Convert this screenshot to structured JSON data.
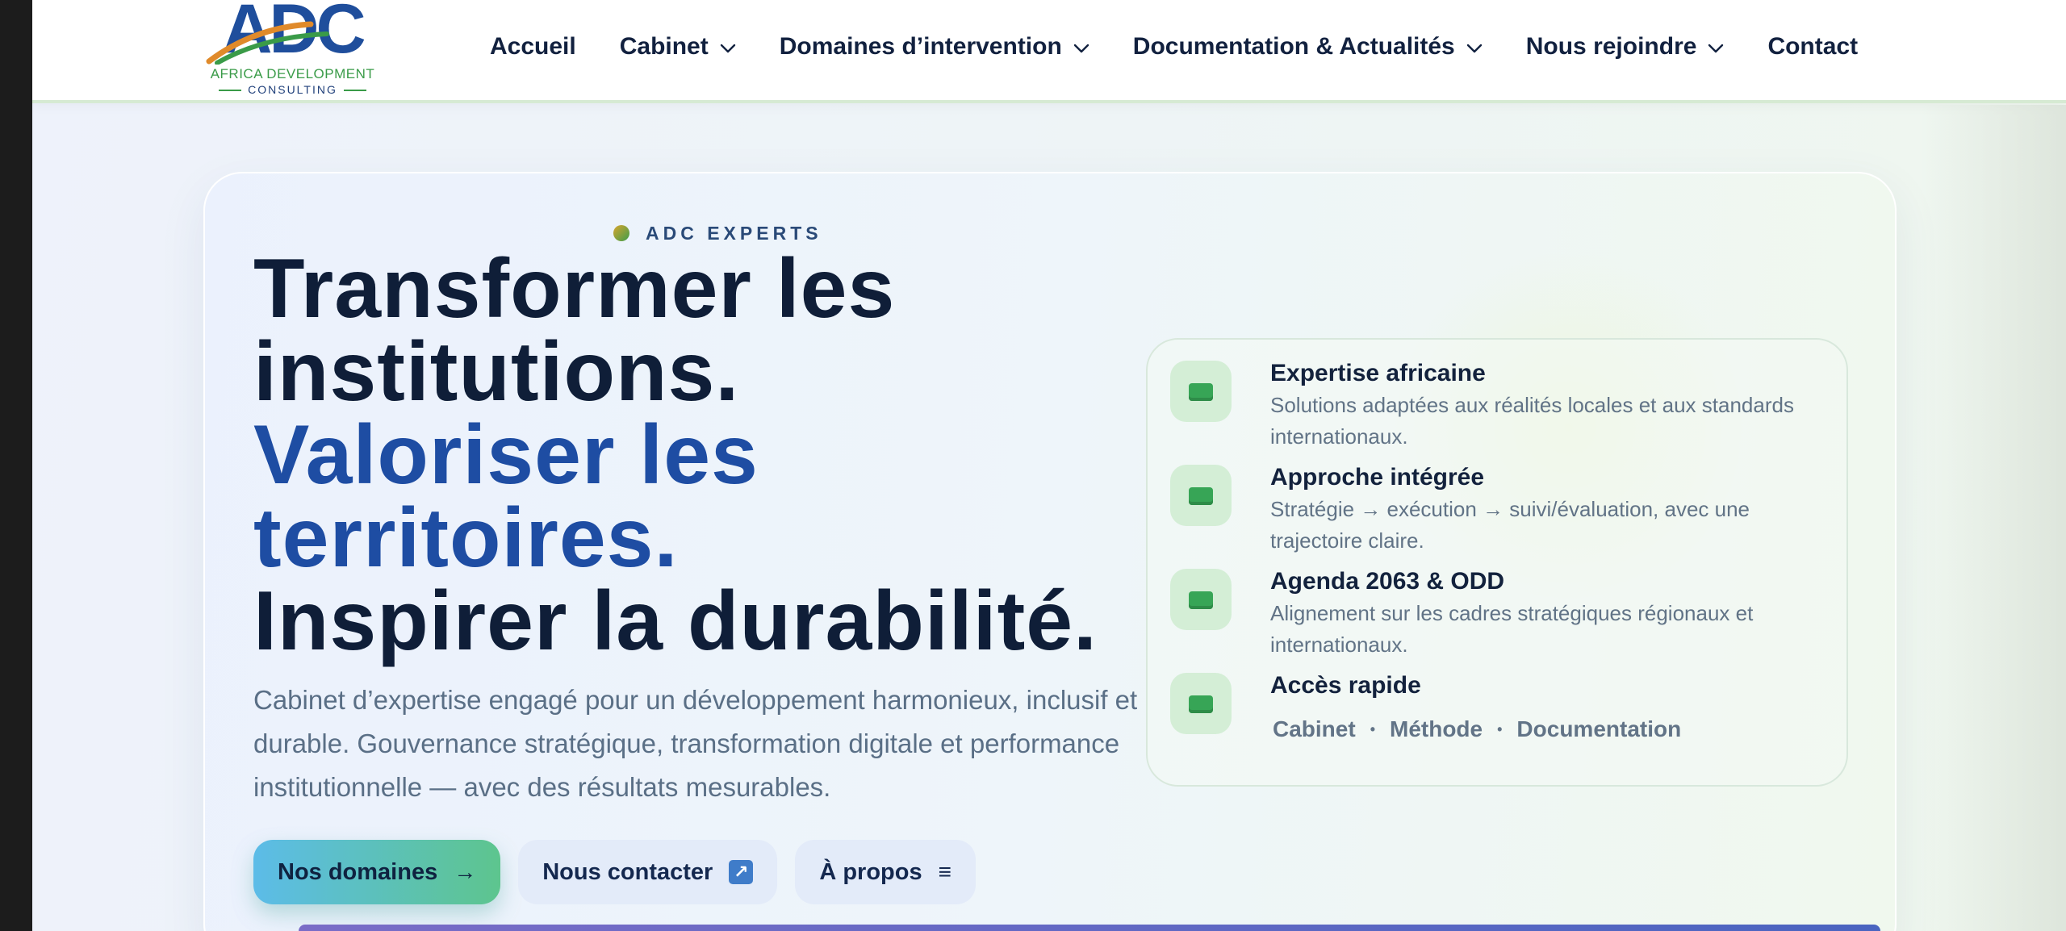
{
  "brand": {
    "logo_letters": "ADC",
    "logo_line1": "AFRICA DEVELOPMENT",
    "logo_line2": "CONSULTING",
    "colors": {
      "blue": "#1f4e9c",
      "green": "#3a9b48",
      "orange": "#e08a2a"
    }
  },
  "nav": {
    "items": [
      {
        "label": "Accueil",
        "has_dropdown": false
      },
      {
        "label": "Cabinet",
        "has_dropdown": true
      },
      {
        "label": "Domaines d’intervention",
        "has_dropdown": true
      },
      {
        "label": "Documentation & Actualités",
        "has_dropdown": true
      },
      {
        "label": "Nous rejoindre",
        "has_dropdown": true
      },
      {
        "label": "Contact",
        "has_dropdown": false
      }
    ],
    "dropdown_icon": "chevron-down-icon"
  },
  "hero": {
    "eyebrow": "ADC EXPERTS",
    "headline": {
      "line1": "Transformer les",
      "line2": "institutions.",
      "line3": "Valoriser les",
      "line4": "territoires.",
      "line5": "Inspirer la durabilité."
    },
    "subtitle": "Cabinet d’expertise engagé pour un développement harmonieux, inclusif et durable. Gouvernance stratégique, transformation digitale et performance institutionnelle — avec des résultats mesurables.",
    "buttons": {
      "primary": {
        "label": "Nos domaines",
        "icon": "→"
      },
      "contact": {
        "label": "Nous contacter",
        "icon": "↗"
      },
      "about": {
        "label": "À propos",
        "icon": "≡"
      }
    },
    "accent_colors": {
      "headline_dark": "#0f1e38",
      "headline_blue": "#1e4da3",
      "button_gradient_start": "#5cbce8",
      "button_gradient_end": "#5dc58e"
    }
  },
  "features": {
    "items": [
      {
        "title": "Expertise africaine",
        "description": "Solutions adaptées aux réalités locales et aux standards internationaux."
      },
      {
        "title": "Approche intégrée",
        "description": "Stratégie → exécution → suivi/évaluation, avec une trajectoire claire."
      },
      {
        "title": "Agenda 2063 & ODD",
        "description": "Alignement sur les cadres stratégiques régionaux et internationaux."
      },
      {
        "title": "Accès rapide",
        "description": ""
      }
    ],
    "quick_links": [
      "Cabinet",
      "Méthode",
      "Documentation"
    ],
    "quick_link_separator": "•"
  }
}
